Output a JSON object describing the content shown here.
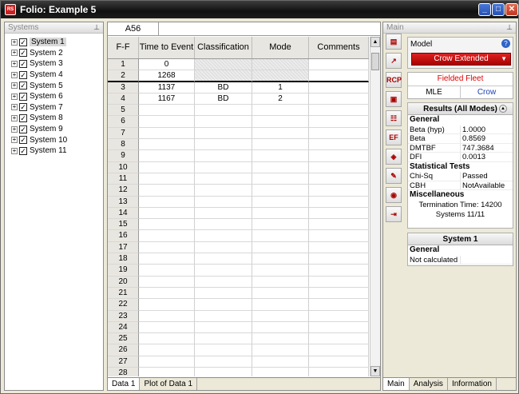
{
  "window": {
    "title": "Folio: Example 5",
    "app_icon": "app-logo-icon"
  },
  "left_panel": {
    "title": "Systems",
    "pin_icon": "pin-icon",
    "tree": [
      {
        "label": "System 1",
        "selected": true
      },
      {
        "label": "System 2"
      },
      {
        "label": "System 3"
      },
      {
        "label": "System 4"
      },
      {
        "label": "System 5"
      },
      {
        "label": "System 6"
      },
      {
        "label": "System 7"
      },
      {
        "label": "System 8"
      },
      {
        "label": "System 9"
      },
      {
        "label": "System 10"
      },
      {
        "label": "System 11"
      }
    ]
  },
  "grid": {
    "cell_ref": "A56",
    "formula": "",
    "headers": [
      "F-F",
      "Time to Event",
      "Classification",
      "Mode",
      "Comments"
    ],
    "rows": [
      {
        "n": "1",
        "time": "0",
        "cls": "",
        "mode": "",
        "comments": ""
      },
      {
        "n": "2",
        "time": "1268",
        "cls": "",
        "mode": "",
        "comments": ""
      },
      {
        "n": "3",
        "time": "1137",
        "cls": "BD",
        "mode": "1",
        "comments": ""
      },
      {
        "n": "4",
        "time": "1167",
        "cls": "BD",
        "mode": "2",
        "comments": ""
      }
    ],
    "empty_row_numbers": [
      "5",
      "6",
      "7",
      "8",
      "9",
      "10",
      "11",
      "12",
      "13",
      "14",
      "15",
      "16",
      "17",
      "18",
      "19",
      "20",
      "21",
      "22",
      "23",
      "24",
      "25",
      "26",
      "27",
      "28"
    ],
    "tabs": [
      "Data 1",
      "Plot of Data 1"
    ]
  },
  "toolbar": {
    "buttons": [
      {
        "name": "plot-icon",
        "glyph": "▤"
      },
      {
        "name": "arrow-chart-icon",
        "glyph": "↗"
      },
      {
        "name": "rcp-icon",
        "glyph": "RCP"
      },
      {
        "name": "report-icon",
        "glyph": "▣"
      },
      {
        "name": "table-icon",
        "glyph": "☷"
      },
      {
        "name": "ef-icon",
        "glyph": "EF"
      },
      {
        "name": "diamond-icon",
        "glyph": "◈"
      },
      {
        "name": "wizard-icon",
        "glyph": "✎"
      },
      {
        "name": "globe-icon",
        "glyph": "◉"
      },
      {
        "name": "export-icon",
        "glyph": "⇥"
      }
    ]
  },
  "right_panel": {
    "title": "Main",
    "pin_icon": "pin-icon",
    "model": {
      "label": "Model",
      "value": "Crow Extended",
      "help_icon": "help-icon"
    },
    "fleet": {
      "title": "Fielded Fleet",
      "left": "MLE",
      "right": "Crow"
    },
    "results": {
      "title": "Results (All Modes)",
      "general_label": "General",
      "general": [
        {
          "k": "Beta (hyp)",
          "v": "1.0000"
        },
        {
          "k": "Beta",
          "v": "0.8569"
        },
        {
          "k": "DMTBF",
          "v": "747.3684"
        },
        {
          "k": "DFI",
          "v": "0.0013"
        }
      ],
      "tests_label": "Statistical Tests",
      "tests": [
        {
          "k": "Chi-Sq",
          "v": "Passed"
        },
        {
          "k": "CBH",
          "v": "NotAvailable"
        }
      ],
      "misc_label": "Miscellaneous",
      "misc": [
        "Termination Time: 14200",
        "Systems 11/11"
      ]
    },
    "system": {
      "title": "System 1",
      "general_label": "General",
      "status": "Not calculated"
    },
    "tabs": [
      "Main",
      "Analysis",
      "Information"
    ]
  }
}
